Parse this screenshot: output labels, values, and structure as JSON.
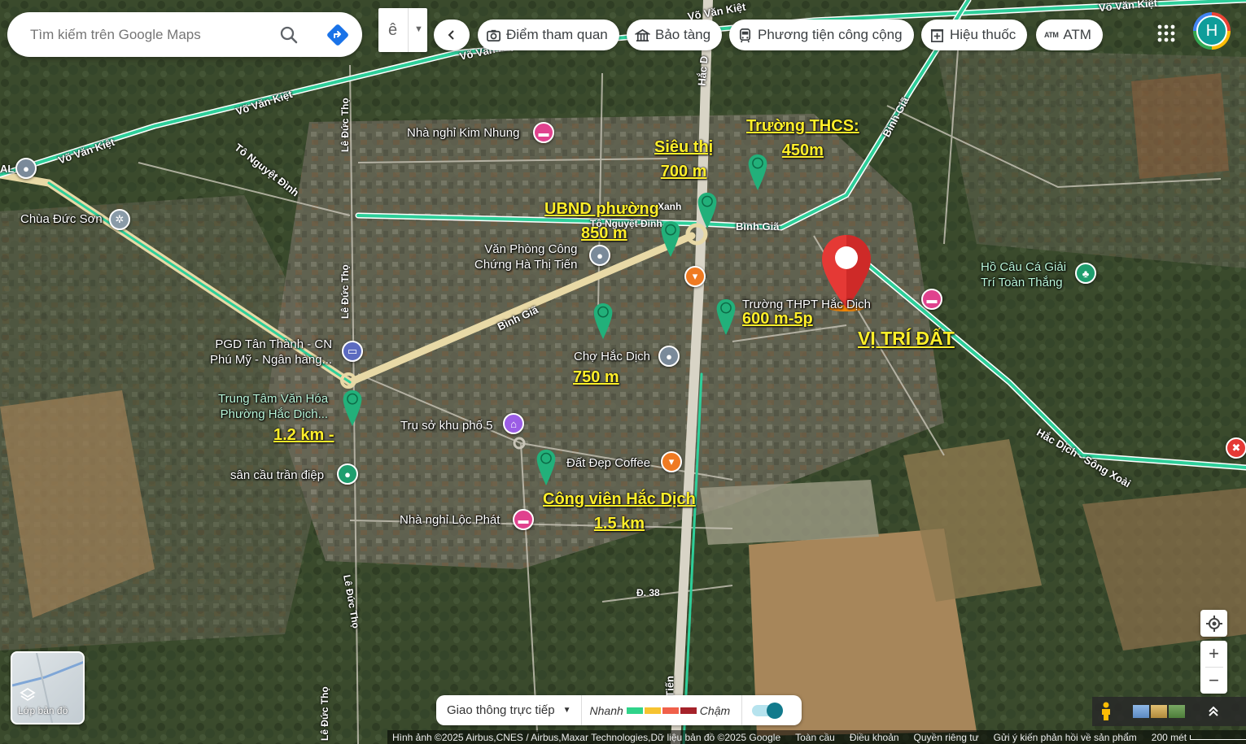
{
  "search": {
    "placeholder": "Tìm kiếm trên Google Maps"
  },
  "top_controls": {
    "dropdown_letter": "ê"
  },
  "categories": [
    {
      "label": "Điểm tham quan",
      "icon": "camera-icon"
    },
    {
      "label": "Bảo tàng",
      "icon": "museum-icon"
    },
    {
      "label": "Phương tiện công cộng",
      "icon": "transit-icon"
    },
    {
      "label": "Hiệu thuốc",
      "icon": "pharmacy-icon"
    },
    {
      "label": "ATM",
      "icon": "atm-icon",
      "icon_text": "ATM"
    }
  ],
  "account": {
    "avatar_letter": "H"
  },
  "roads": {
    "vo_van_kiet_1": "Võ Văn Kiệt",
    "vo_van_kiet_2": "Võ Văn Kiệt",
    "vo_van_kiet_3": "Võ Văn Kiệt",
    "vo_van_kiet_4": "Võ Văn Kiệt",
    "vo_van_kiet_5": "Võ Văn Kiệt",
    "to_nguyet_dinh_1": "Tô Nguyệt Đình",
    "to_nguyet_dinh_2": "Tô Nguyệt Đình",
    "le_duc_tho_1": "Lê Đức Thọ",
    "le_duc_tho_2": "Lê Đức Thọ",
    "le_duc_tho_3": "Lê Đức Thọ",
    "le_duc_tho_4": "Lê Đức Thọ",
    "binh_gia_1": "Bình Giã",
    "binh_gia_2": "Bình Giã",
    "binh_gia_3": "Bình Giã",
    "hac_dich_song_xoai": "Hắc Dịch - Sông Xoài",
    "hac_dich": "Hắc D",
    "d38": "Đ. 38",
    "tien": "Tiến",
    "xanh": "Xanh",
    "al": "AL"
  },
  "places": {
    "nha_nghi_kim_nhung": "Nhà nghỉ Kim Nhung",
    "chua_duc_son": "Chùa Đức Sơn",
    "van_phong_cong_chung_line1": "Văn Phòng Công",
    "van_phong_cong_chung_line2": "Chứng Hà Thị Tiến",
    "truong_thpt": "Trường THPT Hắc Dịch",
    "cho_hac_dich": "Chợ Hắc Dịch",
    "pgd_line1": "PGD Tân Thành - CN",
    "pgd_line2": "Phú Mỹ - Ngân hàng...",
    "trung_tam_line1": "Trung Tâm Văn Hóa",
    "trung_tam_line2": "Phường Hắc Dịch...",
    "tru_so_khu_pho": "Trụ sở khu phố 5",
    "dat_dep_coffee": "Đất Đẹp Coffee",
    "san_cau": "sân cầu trần điệp",
    "nha_nghi_loc_phat": "Nhà nghỉ Lộc Phát",
    "ho_cau_line1": "Hồ Câu Cá Giải",
    "ho_cau_line2": "Trí Toàn Thắng"
  },
  "annotations": {
    "truong_thcs_line1": "Trường  THCS:",
    "truong_thcs_line2": "450m",
    "sieu_thi_line1": "Siêu thị",
    "sieu_thi_line2": "700 m",
    "ubnd_line1": "UBND phường",
    "ubnd_line2": "850 m",
    "thpt_distance": "600 m-5p",
    "cho_distance": "750 m",
    "trung_tam_distance": "1.2 km -",
    "cong_vien_line1": "Công viên Hắc Dịch",
    "cong_vien_line2": "1.5 km",
    "vi_tri_dat": "VỊ TRÍ ĐẤT"
  },
  "layers": {
    "label": "Lớp bản đồ"
  },
  "traffic": {
    "mode_label": "Giao thông trực tiếp",
    "fast_label": "Nhanh",
    "slow_label": "Chậm",
    "colors": [
      "#2fd38a",
      "#f6c330",
      "#f0604a",
      "#a5222a"
    ],
    "toggle_on": true
  },
  "footer": {
    "attribution": "Hình ảnh ©2025 Airbus,CNES / Airbus,Maxar Technologies,Dữ liệu bản đồ ©2025 Google",
    "country": "Toàn cầu",
    "terms": "Điều khoản",
    "privacy": "Quyền riêng tư",
    "feedback": "Gửi ý kiến phản hồi về sản phẩm",
    "scale": "200 mét"
  },
  "colors": {
    "main_road": "#2ecf9a",
    "secondary_road": "#e8d9a6",
    "pin_green": "#22b07a",
    "pin_red": "#e53935",
    "annotation_yellow": "#ffef2a"
  }
}
